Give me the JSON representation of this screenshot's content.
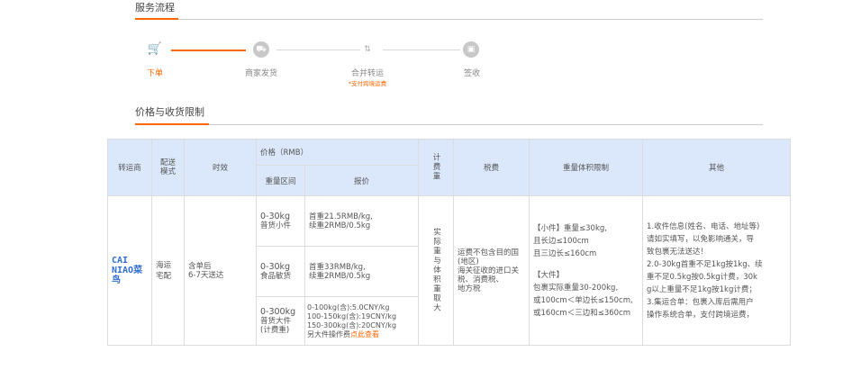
{
  "service_flow": {
    "title": "服务流程",
    "steps": [
      {
        "label": "下单",
        "icon": "cart-icon",
        "active": true,
        "sub": ""
      },
      {
        "label": "商家发货",
        "icon": "truck-icon",
        "active": false,
        "sub": ""
      },
      {
        "label": "合并转运",
        "icon": "merge-icon",
        "active": false,
        "sub": "*支付跨境运费"
      },
      {
        "label": "签收",
        "icon": "package-icon",
        "active": false,
        "sub": ""
      }
    ]
  },
  "pricing": {
    "title": "价格与收货限制",
    "headers": {
      "carrier": "转运商",
      "delivery_mode": "配送模式",
      "timeframe": "时效",
      "price": "价格（RMB）",
      "weight_range": "重量区间",
      "quote": "报价",
      "billing_weight": "计费重",
      "tax": "税费",
      "weight_volume_limit": "重量体积限制",
      "other": "其他"
    },
    "row": {
      "carrier_logo_top": "CAI",
      "carrier_logo_bottom": "NIAO菜鸟",
      "delivery_mode": "海运宅配",
      "timeframe_line1": "含单后",
      "timeframe_line2": "6-7天送达",
      "tiers": [
        {
          "range": "0-30kg",
          "range_sub": "普货小件",
          "quote_lines": [
            "首重21.5RMB/kg,",
            "续重2RMB/0.5kg"
          ],
          "quote_link": ""
        },
        {
          "range": "0-30kg",
          "range_sub": "食品敏货",
          "quote_lines": [
            "首重33RMB/kg,",
            "续重2RMB/0.5kg"
          ],
          "quote_link": ""
        },
        {
          "range": "0-300kg",
          "range_sub": "普货大件(计费重)",
          "quote_lines": [
            "0-100kg(含):5.0CNY/kg",
            "100-150kg(含):19CNY/kg",
            "150-300kg(含):20CNY/kg",
            "另大件操作费"
          ],
          "quote_link": "点此查看"
        }
      ],
      "billing_weight": "实际重与体积重取大",
      "tax_lines": [
        "运费不包含目的国(地区)",
        "海关征收的进口关税、消费税、",
        "地方税"
      ],
      "limit_lines": [
        "【小件】重量≤30kg,",
        "且长边≤100cm",
        "且三边长≤160cm",
        "",
        "【大件】",
        "包裹实际重量30-200kg,",
        "或100cm＜单边长≤150cm,",
        "或160cm＜三边和≤360cm"
      ],
      "other_lines": [
        "1.收件信息(姓名、电话、地址等)",
        "请如实填写，以免影响通关，导",
        "致包裹无法送达！",
        "2.0-30kg首重不足1kg按1kg、续",
        "重不足0.5kg按0.5kg计费，30k",
        "g以上重量不足1kg按1kg计费；",
        "3.集运合单：包裹入库后需用户",
        "操作系统合单，支付跨境运费，"
      ]
    }
  }
}
